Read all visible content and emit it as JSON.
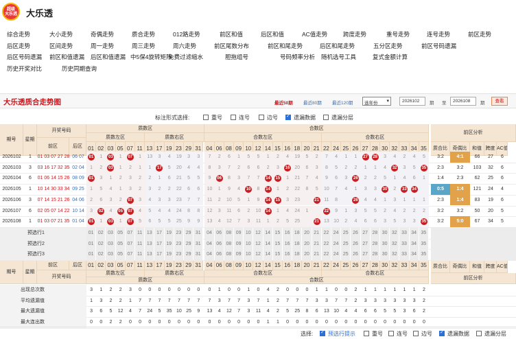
{
  "brand": {
    "logo_lines": [
      "超级",
      "大乐透"
    ],
    "name": "大乐透"
  },
  "nav": [
    [
      "综合走势",
      "大小走势",
      "奇偶走势",
      "质合走势",
      "012路走势",
      "前区和值",
      "后区和值",
      "AC值走势",
      "跨度走势",
      "重号走势",
      "连号走势",
      "前区走势"
    ],
    [
      "后区走势",
      "区间走势",
      "周一走势",
      "周三走势",
      "周六走势",
      "前区尾数分布",
      "前区和尾走势",
      "后区和尾走势",
      "五分区走势",
      "前区号码遗漏"
    ],
    [
      "后区号码遗漏",
      "前区和值遗漏",
      "后区和值遗漏",
      "中5保4旋转矩阵",
      "免费过滤缩水",
      "胆拖组号",
      "号码频率分析",
      "随机选号工具",
      "复式金额计算"
    ],
    [
      "历史开奖对比",
      "历史同期查询"
    ]
  ],
  "title": "大乐透质合走势图",
  "recent": {
    "r50": "最近50期",
    "r80": "最近80期",
    "r120": "最近120期"
  },
  "period_select": "选年份",
  "range": {
    "from": "2026102",
    "label_qi1": "期",
    "to_label": "至",
    "to": "2026108",
    "label_qi2": "期"
  },
  "view_button": "查看",
  "options": {
    "label": "标注形式选择:",
    "items": [
      {
        "label": "重号",
        "checked": false
      },
      {
        "label": "连号",
        "checked": false
      },
      {
        "label": "边号",
        "checked": false
      },
      {
        "label": "遗漏数据",
        "checked": true
      },
      {
        "label": "遗漏分层",
        "checked": false
      }
    ]
  },
  "headers": {
    "qihao": "期号",
    "xingqi": "星期",
    "kaijiang": "开奖号码",
    "front": "前区",
    "back": "后区",
    "zhishu": "质数区",
    "heshu": "合数区",
    "zhi_left": "质数左区",
    "zhi_right": "质数右区",
    "he_left": "合数左区",
    "he_right": "合数右区",
    "analysis": "前区分析",
    "an_cols": [
      "质合比",
      "奇偶比",
      "和值",
      "跨度",
      "AC值"
    ]
  },
  "zhi_nums": [
    "01",
    "02",
    "03",
    "05",
    "07",
    "11",
    "13",
    "17",
    "19",
    "23",
    "29",
    "31"
  ],
  "he_nums": [
    "04",
    "06",
    "08",
    "09",
    "10",
    "12",
    "14",
    "15",
    "16",
    "18",
    "20",
    "21",
    "22",
    "24",
    "25",
    "26",
    "27",
    "28",
    "30",
    "32",
    "33",
    "34",
    "35"
  ],
  "draws": [
    {
      "qi": "2026102",
      "wk": "1",
      "front": "01 03 07 27 28",
      "back": "06 07",
      "balls": [
        "01",
        "03",
        "07",
        "27",
        "28"
      ],
      "zm": [
        "",
        "1",
        "",
        "1",
        "",
        "1",
        "13",
        "3",
        "4",
        "19",
        "3",
        "3"
      ],
      "hm": [
        "7",
        "2",
        "6",
        "1",
        "5",
        "5",
        "1",
        "2",
        "4",
        "19",
        "5",
        "2",
        "7",
        "4",
        "1",
        "1",
        "",
        "",
        "3",
        "4",
        "2",
        "4",
        "5"
      ],
      "an": [
        "3:2",
        "4:1",
        "66",
        "27",
        "6"
      ]
    },
    {
      "qi": "2026103",
      "wk": "3",
      "front": "03 16 17 32 35",
      "back": "02 04",
      "balls": [
        "03",
        "16",
        "17",
        "32",
        "35"
      ],
      "zm": [
        "1",
        "2",
        "",
        "1",
        "2",
        "1",
        "1",
        "",
        "5",
        "20",
        "4",
        "4"
      ],
      "hm": [
        "8",
        "3",
        "7",
        "2",
        "6",
        "6",
        "2",
        "3",
        "",
        "20",
        "6",
        "3",
        "8",
        "5",
        "2",
        "2",
        "1",
        "1",
        "4",
        "",
        "3",
        "5",
        ""
      ],
      "an": [
        "2:3",
        "3:2",
        "103",
        "32",
        "6"
      ]
    },
    {
      "qi": "2026104",
      "wk": "6",
      "front": "01 06 14 15 26",
      "back": "08 09",
      "balls": [
        "01",
        "06",
        "14",
        "15",
        "26"
      ],
      "zm": [
        "",
        "3",
        "1",
        "2",
        "3",
        "2",
        "2",
        "1",
        "6",
        "21",
        "5",
        "5"
      ],
      "hm": [
        "9",
        "",
        "8",
        "3",
        "7",
        "7",
        "",
        "",
        "1",
        "21",
        "7",
        "4",
        "9",
        "6",
        "3",
        "",
        "2",
        "2",
        "5",
        "1",
        "4",
        "6",
        "1"
      ],
      "an": [
        "1:4",
        "2:3",
        "62",
        "25",
        "6"
      ]
    },
    {
      "qi": "2026105",
      "wk": "1",
      "front": "10 14 30 33 34",
      "back": "09 25",
      "balls": [
        "10",
        "14",
        "30",
        "33",
        "34"
      ],
      "zm": [
        "1",
        "5",
        "4",
        "1",
        "3",
        "2",
        "3",
        "2",
        "2",
        "22",
        "6",
        "6"
      ],
      "hm": [
        "10",
        "1",
        "9",
        "4",
        "",
        "8",
        "",
        "1",
        "2",
        "22",
        "8",
        "5",
        "10",
        "7",
        "4",
        "1",
        "3",
        "3",
        "",
        "2",
        "",
        "",
        ""
      ],
      "an": [
        "0:5",
        "1:4",
        "121",
        "24",
        "4"
      ]
    },
    {
      "qi": "2026106",
      "wk": "3",
      "front": "07 14 15 21 26",
      "back": "04 06",
      "balls": [
        "07",
        "14",
        "15",
        "21",
        "26"
      ],
      "zm": [
        "2",
        "6",
        "3",
        "2",
        "",
        "3",
        "4",
        "3",
        "3",
        "23",
        "7",
        "7"
      ],
      "hm": [
        "11",
        "2",
        "10",
        "5",
        "1",
        "9",
        "",
        "",
        "3",
        "23",
        "",
        "6",
        "11",
        "8",
        "",
        "2",
        "4",
        "4",
        "1",
        "3",
        "1",
        "1",
        "1"
      ],
      "an": [
        "2:3",
        "1:4",
        "83",
        "19",
        "6"
      ]
    },
    {
      "qi": "2026107",
      "wk": "6",
      "front": "02 05 07 14 22",
      "back": "10 14",
      "balls": [
        "02",
        "05",
        "07",
        "14",
        "22"
      ],
      "zm": [
        "3",
        "",
        "4",
        "",
        "",
        "4",
        "5",
        "4",
        "4",
        "24",
        "8",
        "8"
      ],
      "hm": [
        "12",
        "3",
        "11",
        "6",
        "2",
        "10",
        "",
        "1",
        "4",
        "24",
        "1",
        "",
        "12",
        "9",
        "1",
        "3",
        "5",
        "5",
        "2",
        "4",
        "2",
        "2",
        "2"
      ],
      "an": [
        "3:2",
        "3:2",
        "50",
        "20",
        "5"
      ]
    },
    {
      "qi": "2026108",
      "wk": "1",
      "front": "01 03 07 21 35",
      "back": "01 04",
      "balls": [
        "01",
        "03",
        "07",
        "21",
        "35"
      ],
      "zm": [
        "",
        "1",
        "",
        "1",
        "",
        "5",
        "6",
        "5",
        "5",
        "25",
        "9",
        "9"
      ],
      "hm": [
        "13",
        "4",
        "12",
        "7",
        "3",
        "11",
        "1",
        "2",
        "5",
        "25",
        "",
        "1",
        "13",
        "10",
        "2",
        "4",
        "6",
        "6",
        "3",
        "5",
        "3",
        "3",
        ""
      ],
      "an": [
        "3:2",
        "5:0",
        "67",
        "34",
        "5"
      ]
    }
  ],
  "predict_rows": [
    "预选行1",
    "预选行2",
    "预选行3"
  ],
  "footer_headers": {
    "qihao": "期号",
    "xingqi": "星期",
    "front": "前区",
    "back": "后区",
    "kaijiang": "开奖号码",
    "zhi_left": "质数左区",
    "zhi_right": "质数右区",
    "zhishu": "质数区",
    "he_left": "合数左区",
    "he_right": "合数右区",
    "heshu": "合数区",
    "analysis": "前区分析",
    "an_cols": [
      "质合比",
      "奇偶比",
      "和值",
      "跨度",
      "AC值"
    ]
  },
  "stats": [
    {
      "label": "出现总次数",
      "z": [
        "3",
        "1",
        "2",
        "2",
        "3",
        "0",
        "0",
        "0",
        "0",
        "0",
        "0",
        "0"
      ],
      "h": [
        "0",
        "1",
        "0",
        "0",
        "1",
        "0",
        "4",
        "2",
        "0",
        "0",
        "0",
        "1",
        "1",
        "0",
        "0",
        "2",
        "1",
        "1",
        "1",
        "1",
        "1",
        "1",
        "2"
      ]
    },
    {
      "label": "平均遗漏值",
      "z": [
        "1",
        "3",
        "2",
        "2",
        "1",
        "7",
        "7",
        "7",
        "7",
        "7",
        "7",
        "7"
      ],
      "h": [
        "7",
        "3",
        "7",
        "7",
        "3",
        "7",
        "1",
        "2",
        "7",
        "7",
        "7",
        "3",
        "3",
        "7",
        "7",
        "2",
        "3",
        "3",
        "3",
        "3",
        "3",
        "3",
        "2"
      ]
    },
    {
      "label": "最大遗漏值",
      "z": [
        "3",
        "6",
        "5",
        "12",
        "4",
        "7",
        "24",
        "5",
        "35",
        "10",
        "25",
        "9"
      ],
      "h": [
        "13",
        "4",
        "12",
        "7",
        "3",
        "11",
        "4",
        "2",
        "5",
        "25",
        "8",
        "6",
        "13",
        "10",
        "4",
        "4",
        "6",
        "6",
        "5",
        "5",
        "3",
        "6",
        "2"
      ]
    },
    {
      "label": "最大连出数",
      "z": [
        "0",
        "0",
        "2",
        "2",
        "0",
        "0",
        "0",
        "0",
        "0",
        "0",
        "0",
        "0"
      ],
      "h": [
        "0",
        "0",
        "0",
        "0",
        "0",
        "0",
        "1",
        "1",
        "0",
        "0",
        "0",
        "0",
        "0",
        "0",
        "0",
        "0",
        "0",
        "0",
        "0",
        "0",
        "0",
        "0",
        "0"
      ]
    }
  ],
  "bottom": {
    "label": "选择:",
    "items": [
      {
        "label": "预选行提示",
        "checked": true,
        "accent": true
      },
      {
        "label": "重号",
        "checked": false
      },
      {
        "label": "连号",
        "checked": false
      },
      {
        "label": "边号",
        "checked": false
      },
      {
        "label": "遗漏数据",
        "checked": true
      },
      {
        "label": "遗漏分层",
        "checked": false
      }
    ]
  },
  "colors": {
    "accent_red": "#c81e22",
    "header_bg": "#f5e6d3",
    "link_blue": "#3c6eb4",
    "ratio_blue": "#5aa6c8",
    "ratio_orange": "#e2a24a"
  }
}
